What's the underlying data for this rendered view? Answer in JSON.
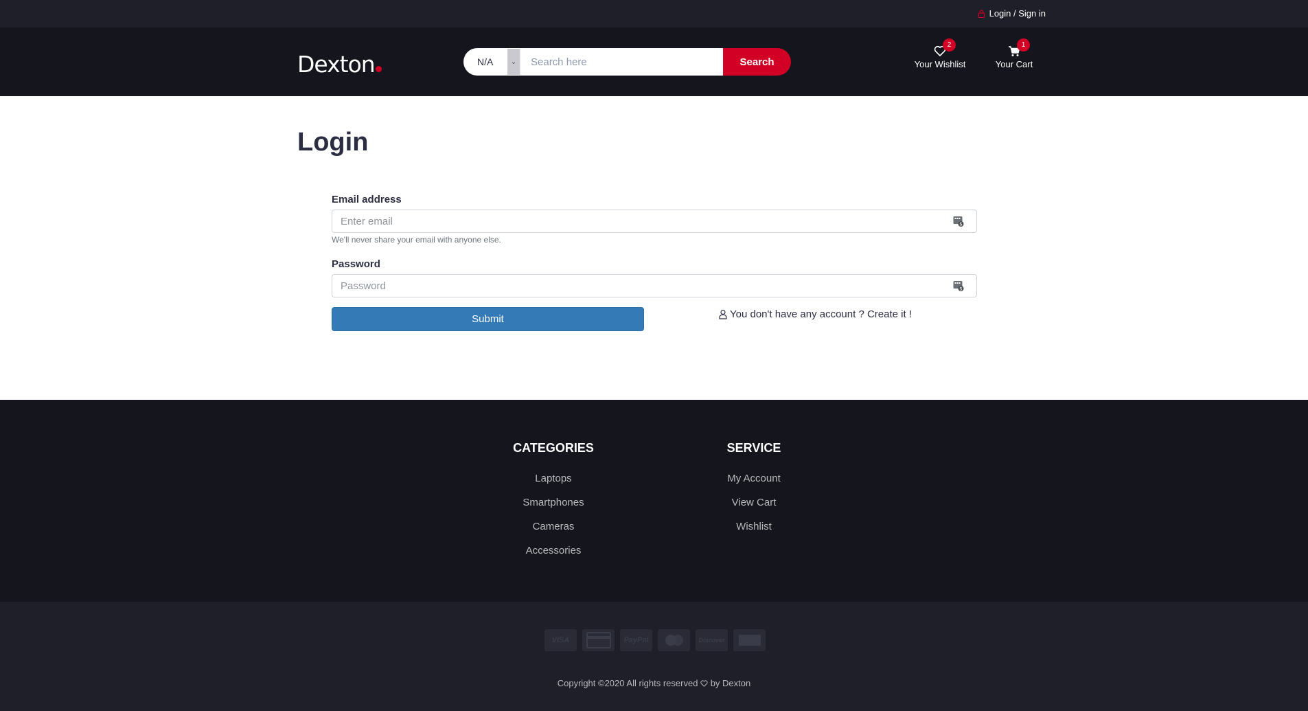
{
  "top_bar": {
    "login_label": "Login / Sign in"
  },
  "header": {
    "logo_text": "Dexton",
    "search": {
      "category_value": "N/A",
      "placeholder": "Search here",
      "button_label": "Search"
    },
    "wishlist": {
      "label": "Your Wishlist",
      "count": "2"
    },
    "cart": {
      "label": "Your Cart",
      "count": "1"
    }
  },
  "main": {
    "title": "Login",
    "email": {
      "label": "Email address",
      "placeholder": "Enter email",
      "help": "We'll never share your email with anyone else."
    },
    "password": {
      "label": "Password",
      "placeholder": "Password"
    },
    "submit_label": "Submit",
    "create_account_text": "You don't have any account ? Create it !"
  },
  "footer": {
    "categories": {
      "title": "CATEGORIES",
      "links": [
        "Laptops",
        "Smartphones",
        "Cameras",
        "Accessories"
      ]
    },
    "service": {
      "title": "SERVICE",
      "links": [
        "My Account",
        "View Cart",
        "Wishlist"
      ]
    }
  },
  "bottom_footer": {
    "payment_methods": [
      "VISA",
      "Credit Card",
      "PayPal",
      "Mastercard",
      "Discover",
      "American Express"
    ],
    "payment_icon_text": [
      "VISA",
      "",
      "PayPal",
      "",
      "Discover",
      ""
    ],
    "copyright_before": "Copyright ©2020 All rights reserved",
    "copyright_after": "by Dexton"
  },
  "colors": {
    "accent": "#d10024",
    "header_bg": "#15161d",
    "top_bar_bg": "#1e1f29",
    "submit_bg": "#337ab7"
  }
}
